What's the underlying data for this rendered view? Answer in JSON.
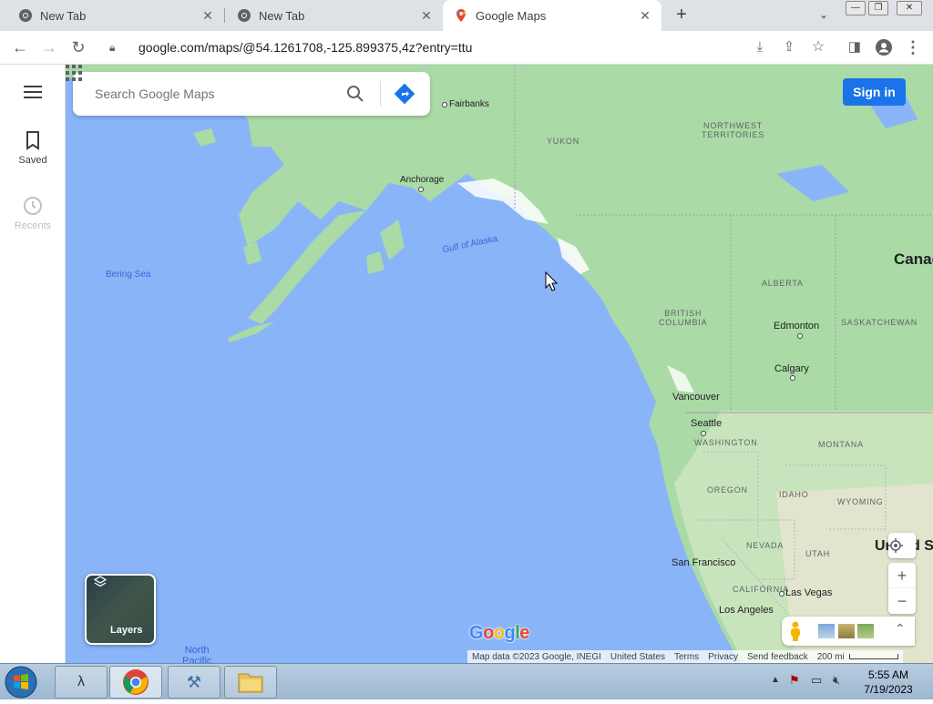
{
  "browser": {
    "tabs": [
      {
        "label": "New Tab",
        "icon": "chrome-icon"
      },
      {
        "label": "New Tab",
        "icon": "chrome-icon"
      },
      {
        "label": "Google Maps",
        "icon": "maps-pin-icon",
        "active": true
      }
    ],
    "url": "google.com/maps/@54.1261708,-125.899375,4z?entry=ttu"
  },
  "rail": {
    "saved_label": "Saved",
    "recents_label": "Recents"
  },
  "search": {
    "placeholder": "Search Google Maps"
  },
  "header": {
    "signin_label": "Sign in"
  },
  "map_labels": {
    "fairbanks": "Fairbanks",
    "yukon": "YUKON",
    "nwt": "NORTHWEST\nTERRITORIES",
    "anchorage": "Anchorage",
    "gulf": "Gulf of Alaska",
    "bering": "Bering Sea",
    "canada": "Canad",
    "bc": "BRITISH\nCOLUMBIA",
    "alberta": "ALBERTA",
    "saskatchewan": "SASKATCHEWAN",
    "edmonton": "Edmonton",
    "calgary": "Calgary",
    "vancouver": "Vancouver",
    "seattle": "Seattle",
    "washington": "WASHINGTON",
    "montana": "MONTANA",
    "oregon": "OREGON",
    "idaho": "IDAHO",
    "wyoming": "WYOMING",
    "nevada": "NEVADA",
    "utah": "UTAH",
    "us": "United S",
    "sanfrancisco": "San Francisco",
    "california": "CALIFORNIA",
    "lasvegas": "Las Vegas",
    "losangeles": "Los Angeles",
    "northpacific": "North\nPacific"
  },
  "layers": {
    "label": "Layers"
  },
  "footer": {
    "map_data": "Map data ©2023 Google, INEGI",
    "country": "United States",
    "terms": "Terms",
    "privacy": "Privacy",
    "feedback": "Send feedback",
    "scale": "200 mi"
  },
  "taskbar": {
    "time": "5:55 AM",
    "date": "7/19/2023"
  },
  "colors": {
    "water": "#8ab4f8",
    "land": "#aadaa5",
    "accent": "#1a73e8"
  }
}
